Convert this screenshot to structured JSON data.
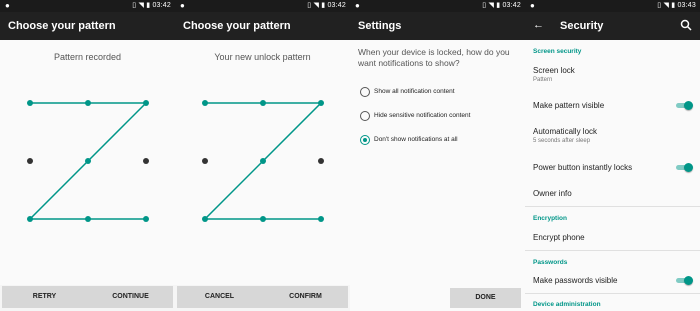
{
  "status": {
    "time_1": "03:42",
    "time_2": "03:42",
    "time_3": "03:42",
    "time_4": "03:43"
  },
  "screen1": {
    "title": "Choose your pattern",
    "message": "Pattern recorded",
    "left_button": "RETRY",
    "right_button": "CONTINUE"
  },
  "screen2": {
    "title": "Choose your pattern",
    "message": "Your new unlock pattern",
    "left_button": "CANCEL",
    "right_button": "CONFIRM"
  },
  "screen3": {
    "title": "Settings",
    "question": "When your device is locked, how do you want notifications to show?",
    "options": [
      {
        "label": "Show all notification content",
        "selected": false
      },
      {
        "label": "Hide sensitive notification content",
        "selected": false
      },
      {
        "label": "Don't show notifications at all",
        "selected": true
      }
    ],
    "done_button": "DONE"
  },
  "screen4": {
    "title": "Security",
    "cat_screen_security": "Screen security",
    "screen_lock_title": "Screen lock",
    "screen_lock_sub": "Pattern",
    "make_pattern_visible": "Make pattern visible",
    "auto_lock_title": "Automatically lock",
    "auto_lock_sub": "5 seconds after sleep",
    "power_button_lock": "Power button instantly locks",
    "owner_info": "Owner info",
    "cat_encryption": "Encryption",
    "encrypt_phone": "Encrypt phone",
    "cat_passwords": "Passwords",
    "make_passwords_visible": "Make passwords visible",
    "cat_device_admin": "Device administration"
  },
  "colors": {
    "accent": "#009688",
    "appbar": "#212121",
    "statusbar": "#1b1b1b",
    "button_bar": "#d7d7d7"
  },
  "icons": [
    "lightbulb-icon",
    "vibrate-icon",
    "no-signal-icon",
    "battery-icon",
    "back-arrow-icon",
    "search-icon"
  ]
}
